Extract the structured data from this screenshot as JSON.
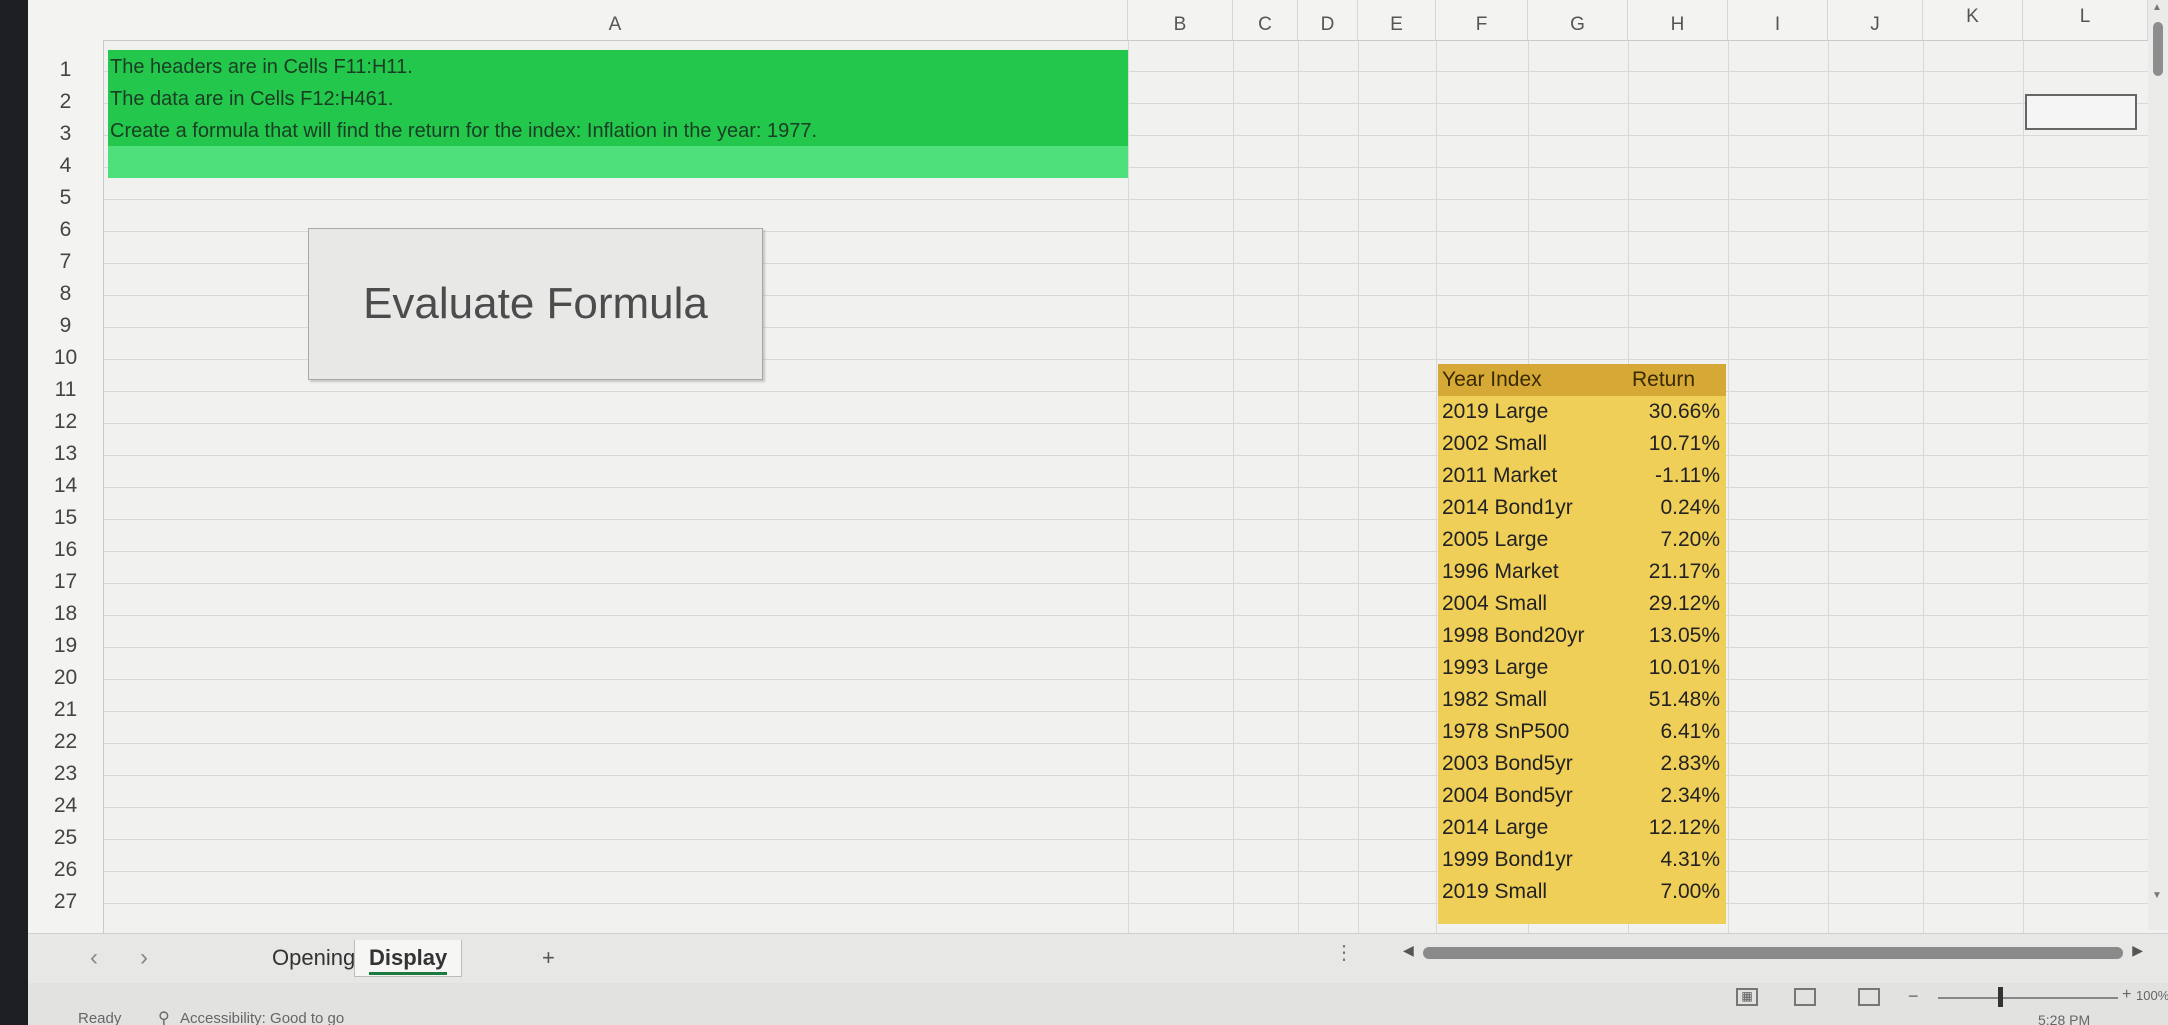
{
  "columns": [
    "A",
    "B",
    "C",
    "D",
    "E",
    "F",
    "G",
    "H",
    "I",
    "J",
    "K",
    "L"
  ],
  "rows": [
    "1",
    "2",
    "3",
    "4",
    "5",
    "6",
    "7",
    "8",
    "9",
    "10",
    "11",
    "12",
    "13",
    "14",
    "15",
    "16",
    "17",
    "18",
    "19",
    "20",
    "21",
    "22",
    "23",
    "24",
    "25",
    "26",
    "27"
  ],
  "instructions": [
    "The headers are in Cells F11:H11.",
    "The data are in Cells F12:H461.",
    "Create a formula that will find the return for the index: Inflation in the year: 1977."
  ],
  "button": {
    "label": "Evaluate Formula"
  },
  "table": {
    "headers": {
      "year_index": "Year  Index",
      "return": "Return"
    },
    "rows": [
      {
        "yi": "2019 Large",
        "ret": "30.66%"
      },
      {
        "yi": "2002 Small",
        "ret": "10.71%"
      },
      {
        "yi": "2011 Market",
        "ret": "-1.11%"
      },
      {
        "yi": "2014 Bond1yr",
        "ret": "0.24%"
      },
      {
        "yi": "2005 Large",
        "ret": "7.20%"
      },
      {
        "yi": "1996 Market",
        "ret": "21.17%"
      },
      {
        "yi": "2004 Small",
        "ret": "29.12%"
      },
      {
        "yi": "1998 Bond20yr",
        "ret": "13.05%"
      },
      {
        "yi": "1993 Large",
        "ret": "10.01%"
      },
      {
        "yi": "1982 Small",
        "ret": "51.48%"
      },
      {
        "yi": "1978 SnP500",
        "ret": "6.41%"
      },
      {
        "yi": "2003 Bond5yr",
        "ret": "2.83%"
      },
      {
        "yi": "2004 Bond5yr",
        "ret": "2.34%"
      },
      {
        "yi": "2014 Large",
        "ret": "12.12%"
      },
      {
        "yi": "1999 Bond1yr",
        "ret": "4.31%"
      },
      {
        "yi": "2019 Small",
        "ret": "7.00%"
      }
    ]
  },
  "sheet_tabs": {
    "opening": "Opening",
    "display": "Display",
    "add": "+"
  },
  "status": {
    "ready": "Ready",
    "accessibility": "Accessibility: Good to go",
    "zoom": "100%",
    "time": "5:28 PM"
  },
  "colors": {
    "banner_green": "#22c74c",
    "table_yellow": "#f0cf58",
    "table_header": "#d6a936"
  }
}
